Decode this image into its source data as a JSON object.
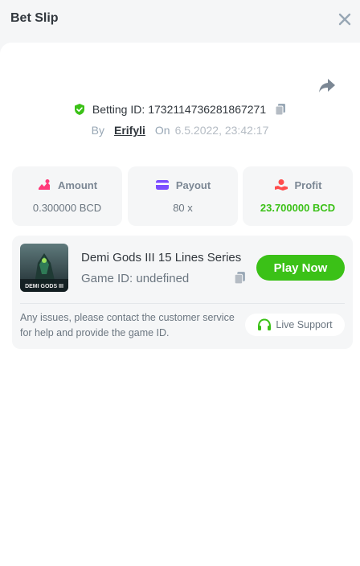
{
  "header": {
    "title": "Bet Slip"
  },
  "bet": {
    "id_label": "Betting ID:",
    "id_value": "1732114736281867271",
    "by_label": "By",
    "user": "Erifyli",
    "on_label": "On",
    "datetime": "6.5.2022, 23:42:17"
  },
  "stats": {
    "amount": {
      "label": "Amount",
      "value": "0.300000 BCD"
    },
    "payout": {
      "label": "Payout",
      "value": "80 x"
    },
    "profit": {
      "label": "Profit",
      "value": "23.700000 BCD"
    }
  },
  "game": {
    "name": "Demi Gods III 15 Lines Series",
    "id_label": "Game ID:",
    "id_value": "undefined",
    "thumb_text": "DEMI GODS III",
    "play_label": "Play Now",
    "issue_text": "Any issues, please contact the customer service for help and provide the game ID.",
    "support_label": "Live Support"
  },
  "colors": {
    "accent_green": "#3bc117",
    "pink": "#ff3a7a",
    "purple": "#7b4dff",
    "red": "#ff4d4d"
  }
}
